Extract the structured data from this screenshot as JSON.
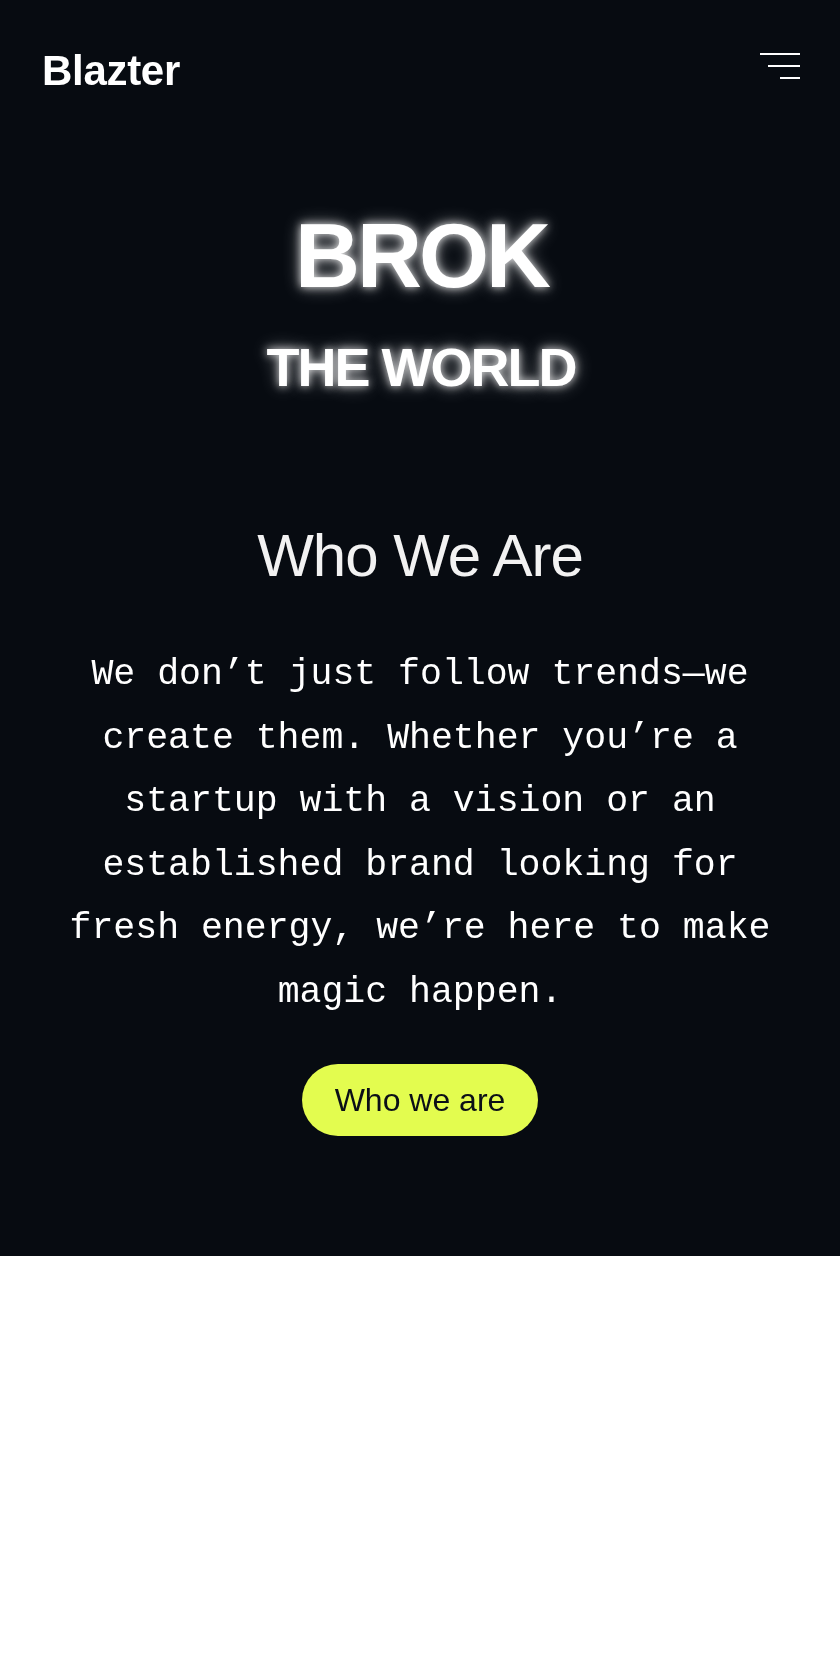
{
  "header": {
    "logo": "Blazter"
  },
  "hero": {
    "title": "BROK",
    "subtitle": "THE WORLD"
  },
  "about": {
    "heading": "Who We Are",
    "body": "We don’t just follow trends—we create them. Whether you’re a startup with a vision or an established brand looking for fresh energy, we’re here to make magic happen.",
    "button": "Who we are"
  }
}
